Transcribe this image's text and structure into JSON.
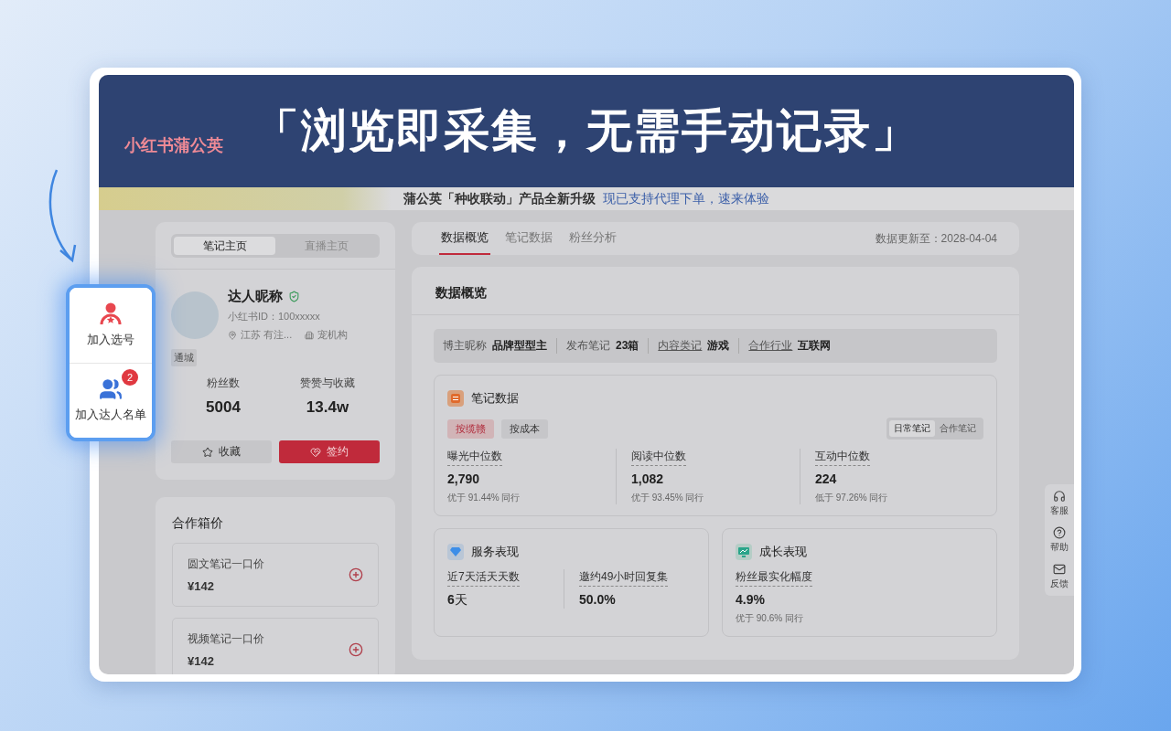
{
  "headline": "「浏览即采集，无需手动记录」",
  "header": {
    "logo": "小红书蒲公英"
  },
  "banner": {
    "text": "蒲公英「种收联动」产品全新升级",
    "link": "现已支持代理下单，速来体验"
  },
  "floating_panel": {
    "items": [
      {
        "kind": "select",
        "label": "加入选号"
      },
      {
        "kind": "list",
        "label": "加入达人名单",
        "badge": "2"
      }
    ]
  },
  "profile_card": {
    "tabs": [
      {
        "label": "笔记主页",
        "selected": true
      },
      {
        "label": "直播主页",
        "selected": false
      }
    ],
    "name": "达人昵称",
    "verified": true,
    "id": "小红书ID：100xxxxx",
    "location": "江苏 有注...",
    "organization": "宠机构",
    "tag": "通城",
    "stats": [
      {
        "label": "粉丝数",
        "value": "5004"
      },
      {
        "label": "赞赞与收藏",
        "value": "13.4w"
      }
    ],
    "buttons": [
      {
        "kind": "secondary",
        "label": "收藏"
      },
      {
        "kind": "primary",
        "label": "签约"
      }
    ]
  },
  "pricing": {
    "title": "合作箱价",
    "items": [
      {
        "label": "圆文笔记一口价",
        "price": "¥142"
      },
      {
        "label": "视频笔记一口价",
        "price": "¥142"
      }
    ]
  },
  "tabs": [
    {
      "label": "数据概览",
      "selected": true
    },
    {
      "label": "笔记数据",
      "selected": false
    },
    {
      "label": "粉丝分析",
      "selected": false
    }
  ],
  "updated": "数据更新至：2028-04-04",
  "overview": {
    "title": "数据概览",
    "facts": [
      {
        "label": "博主昵称",
        "value": "品牌型型主",
        "underlined": false
      },
      {
        "label": "发布笔记",
        "value": "23箱",
        "underlined": false
      },
      {
        "label": "内容类记",
        "value": "游戏",
        "underlined": true
      },
      {
        "label": "合作行业",
        "value": "互联网",
        "underlined": true
      }
    ]
  },
  "notes_section": {
    "title": "笔记数据",
    "filters": [
      {
        "label": "按缆赣",
        "selected": true
      },
      {
        "label": "按成本",
        "selected": false
      }
    ],
    "note_types": [
      {
        "label": "日常笔记",
        "selected": true
      },
      {
        "label": "合作笔记",
        "selected": false
      }
    ],
    "metrics": [
      {
        "label": "曝光中位数",
        "value": "2,790",
        "note": "优于 91.44% 同行"
      },
      {
        "label": "阅读中位数",
        "value": "1,082",
        "note": "优于 93.45% 同行"
      },
      {
        "label": "互动中位数",
        "value": "224",
        "note": "低于 97.26% 同行"
      }
    ]
  },
  "panels": [
    {
      "kind": "service",
      "title": "服务表现",
      "metrics": [
        {
          "label": "近7天活天天数",
          "value": "**6**天"
        },
        {
          "label": "邀约49小时回复集",
          "value": "50.0%"
        }
      ]
    },
    {
      "kind": "growth",
      "title": "成长表现",
      "metrics": [
        {
          "label": "粉丝最实化幅度",
          "value": "4.9%",
          "note": "优于 90.6% 同行"
        }
      ]
    }
  ],
  "side_rail": [
    {
      "kind": "headset",
      "label": "客服"
    },
    {
      "kind": "help",
      "label": "帮助"
    },
    {
      "kind": "mail",
      "label": "反馈"
    }
  ]
}
